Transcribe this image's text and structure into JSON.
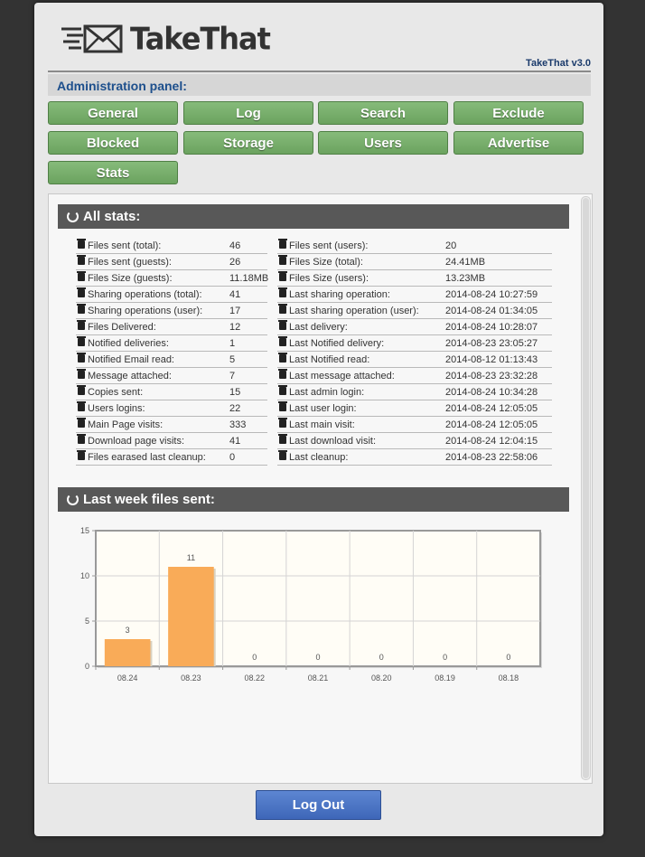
{
  "app": {
    "name": "TakeThat",
    "version": "TakeThat v3.0"
  },
  "admin_label": "Administration panel:",
  "nav": [
    "General",
    "Log",
    "Search",
    "Exclude",
    "Blocked",
    "Storage",
    "Users",
    "Advertise",
    "Stats"
  ],
  "all_stats": {
    "title": "All stats:",
    "rows": [
      [
        "Files sent (total):",
        "46",
        "Files sent (users):",
        "20"
      ],
      [
        "Files sent (guests):",
        "26",
        "Files Size (total):",
        "24.41MB"
      ],
      [
        "Files Size (guests):",
        "11.18MB",
        "Files Size (users):",
        "13.23MB"
      ],
      [
        "Sharing operations (total):",
        "41",
        "Last sharing operation:",
        "2014-08-24 10:27:59"
      ],
      [
        "Sharing operations (user):",
        "17",
        "Last sharing operation (user):",
        "2014-08-24 01:34:05"
      ],
      [
        "Files Delivered:",
        "12",
        "Last delivery:",
        "2014-08-24 10:28:07"
      ],
      [
        "Notified deliveries:",
        "1",
        "Last Notified delivery:",
        "2014-08-23 23:05:27"
      ],
      [
        "Notified Email read:",
        "5",
        "Last Notified read:",
        "2014-08-12 01:13:43"
      ],
      [
        "Message attached:",
        "7",
        "Last message attached:",
        "2014-08-23 23:32:28"
      ],
      [
        "Copies sent:",
        "15",
        "Last admin login:",
        "2014-08-24 10:34:28"
      ],
      [
        "Users logins:",
        "22",
        "Last user login:",
        "2014-08-24 12:05:05"
      ],
      [
        "Main Page visits:",
        "333",
        "Last main visit:",
        "2014-08-24 12:05:05"
      ],
      [
        "Download page visits:",
        "41",
        "Last download visit:",
        "2014-08-24 12:04:15"
      ],
      [
        "Files earased last cleanup:",
        "0",
        "Last cleanup:",
        "2014-08-23 22:58:06"
      ]
    ]
  },
  "week_section": {
    "title": "Last week files sent:"
  },
  "chart_data": {
    "type": "bar",
    "categories": [
      "08.24",
      "08.23",
      "08.22",
      "08.21",
      "08.20",
      "08.19",
      "08.18"
    ],
    "values": [
      3,
      11,
      0,
      0,
      0,
      0,
      0
    ],
    "yticks": [
      "0",
      "5",
      "10",
      "15"
    ],
    "ylim": [
      0,
      15
    ],
    "grid": true,
    "bar_color": "#f9ab58"
  },
  "logout_label": "Log Out",
  "colors": {
    "nav_button": "#78ae6c",
    "logout_button": "#4a72c4",
    "section_header": "#585858",
    "admin_label": "#1d4f8c"
  },
  "icons": {
    "stat_row": "trash-bin-icon",
    "section": "refresh-icon",
    "logo": "envelope-icon"
  }
}
